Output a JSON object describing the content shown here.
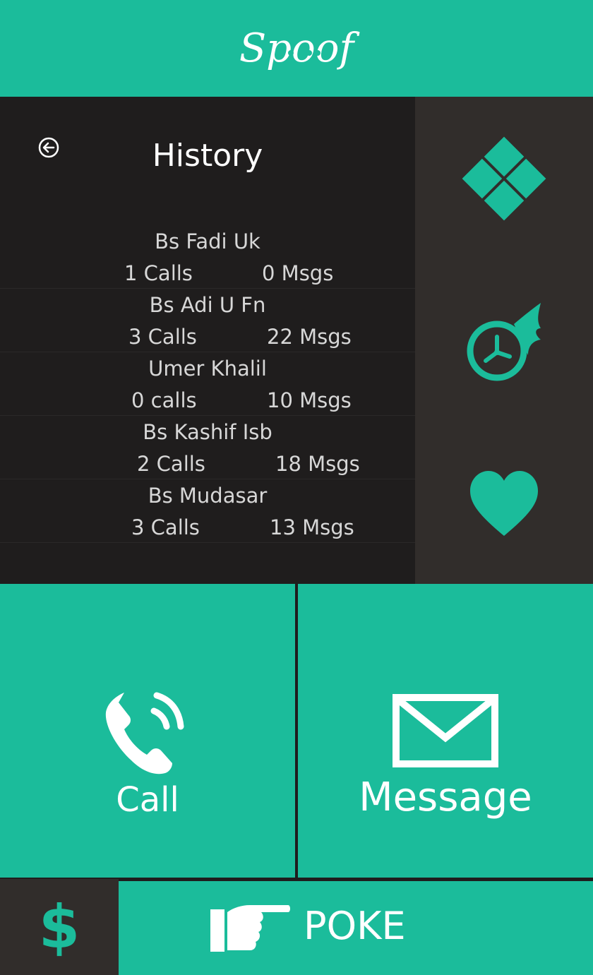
{
  "app": {
    "logo_text": "Spoof"
  },
  "history": {
    "title": "History",
    "items": [
      {
        "name": "Bs Fadi Uk",
        "calls": "1 Calls",
        "msgs": "0 Msgs"
      },
      {
        "name": "Bs Adi U Fn",
        "calls": "3 Calls",
        "msgs": "22 Msgs"
      },
      {
        "name": "Umer Khalil",
        "calls": "0 calls",
        "msgs": "10 Msgs"
      },
      {
        "name": "Bs Kashif Isb",
        "calls": "2 Calls",
        "msgs": "18 Msgs"
      },
      {
        "name": "Bs Mudasar",
        "calls": "3 Calls",
        "msgs": "13 Msgs"
      }
    ]
  },
  "side": {
    "icons": [
      "grid-diamond-icon",
      "speed-clock-icon",
      "heart-icon"
    ]
  },
  "actions": {
    "call_label": "Call",
    "message_label": "Message"
  },
  "bottom": {
    "dollar": "$",
    "poke_label": "POKE"
  },
  "colors": {
    "accent": "#1bbc9b",
    "dark": "#1f1d1d",
    "panel": "#312d2b"
  }
}
